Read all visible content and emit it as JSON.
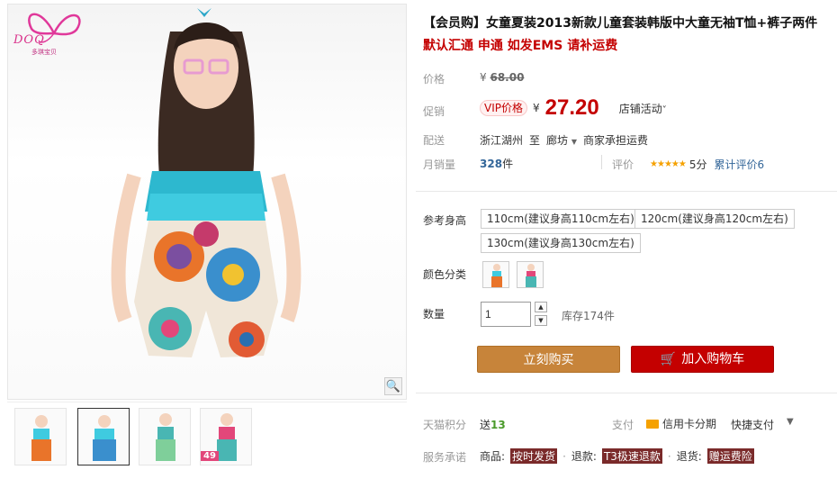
{
  "brand": {
    "logo_text": "DOQ",
    "logo_sub": "多琪宝贝"
  },
  "product": {
    "title": "【会员购】女童夏装2013新款儿童套装韩版中大童无袖T恤+裤子两件",
    "subtitle": "默认汇通 申通 如发EMS 请补运费"
  },
  "price": {
    "label": "价格",
    "currency": "¥",
    "original": "68.00",
    "promo_label": "促销",
    "vip_badge": "VIP价格",
    "vip_value": "27.20",
    "store_activity": "店铺活动"
  },
  "shipping": {
    "label": "配送",
    "from": "浙江湖州",
    "to_word": "至",
    "to": "廊坊",
    "fee": "商家承担运费"
  },
  "sales": {
    "label": "月销量",
    "count": "328",
    "unit": "件",
    "rating_label": "评价",
    "stars": "★★★★★",
    "score": "5分",
    "review_count": "累计评价6"
  },
  "sku": {
    "size_label": "参考身高",
    "sizes": [
      "110cm(建议身高110cm左右)",
      "120cm(建议身高120cm左右)",
      "130cm(建议身高130cm左右)"
    ],
    "color_label": "颜色分类",
    "qty_label": "数量",
    "qty_value": "1",
    "stock": "库存174件"
  },
  "actions": {
    "buy_now": "立刻购买",
    "add_cart": "加入购物车"
  },
  "footer": {
    "points_label": "天猫积分",
    "points_prefix": "送",
    "points_value": "13",
    "pay_label": "支付",
    "pay_credit": "信用卡分期",
    "pay_fast": "快捷支付",
    "promise_label": "服务承诺",
    "goods_label": "商品:",
    "goods_tag": "按时发货",
    "refund_label": "退款:",
    "refund_tag": "T3极速退款",
    "return_label": "退货:",
    "return_tag": "赠运费险"
  },
  "thumb_badge": "49",
  "colors": {
    "accent": "#c40000",
    "buy": "#c7843a",
    "green": "#4a9a2a"
  }
}
